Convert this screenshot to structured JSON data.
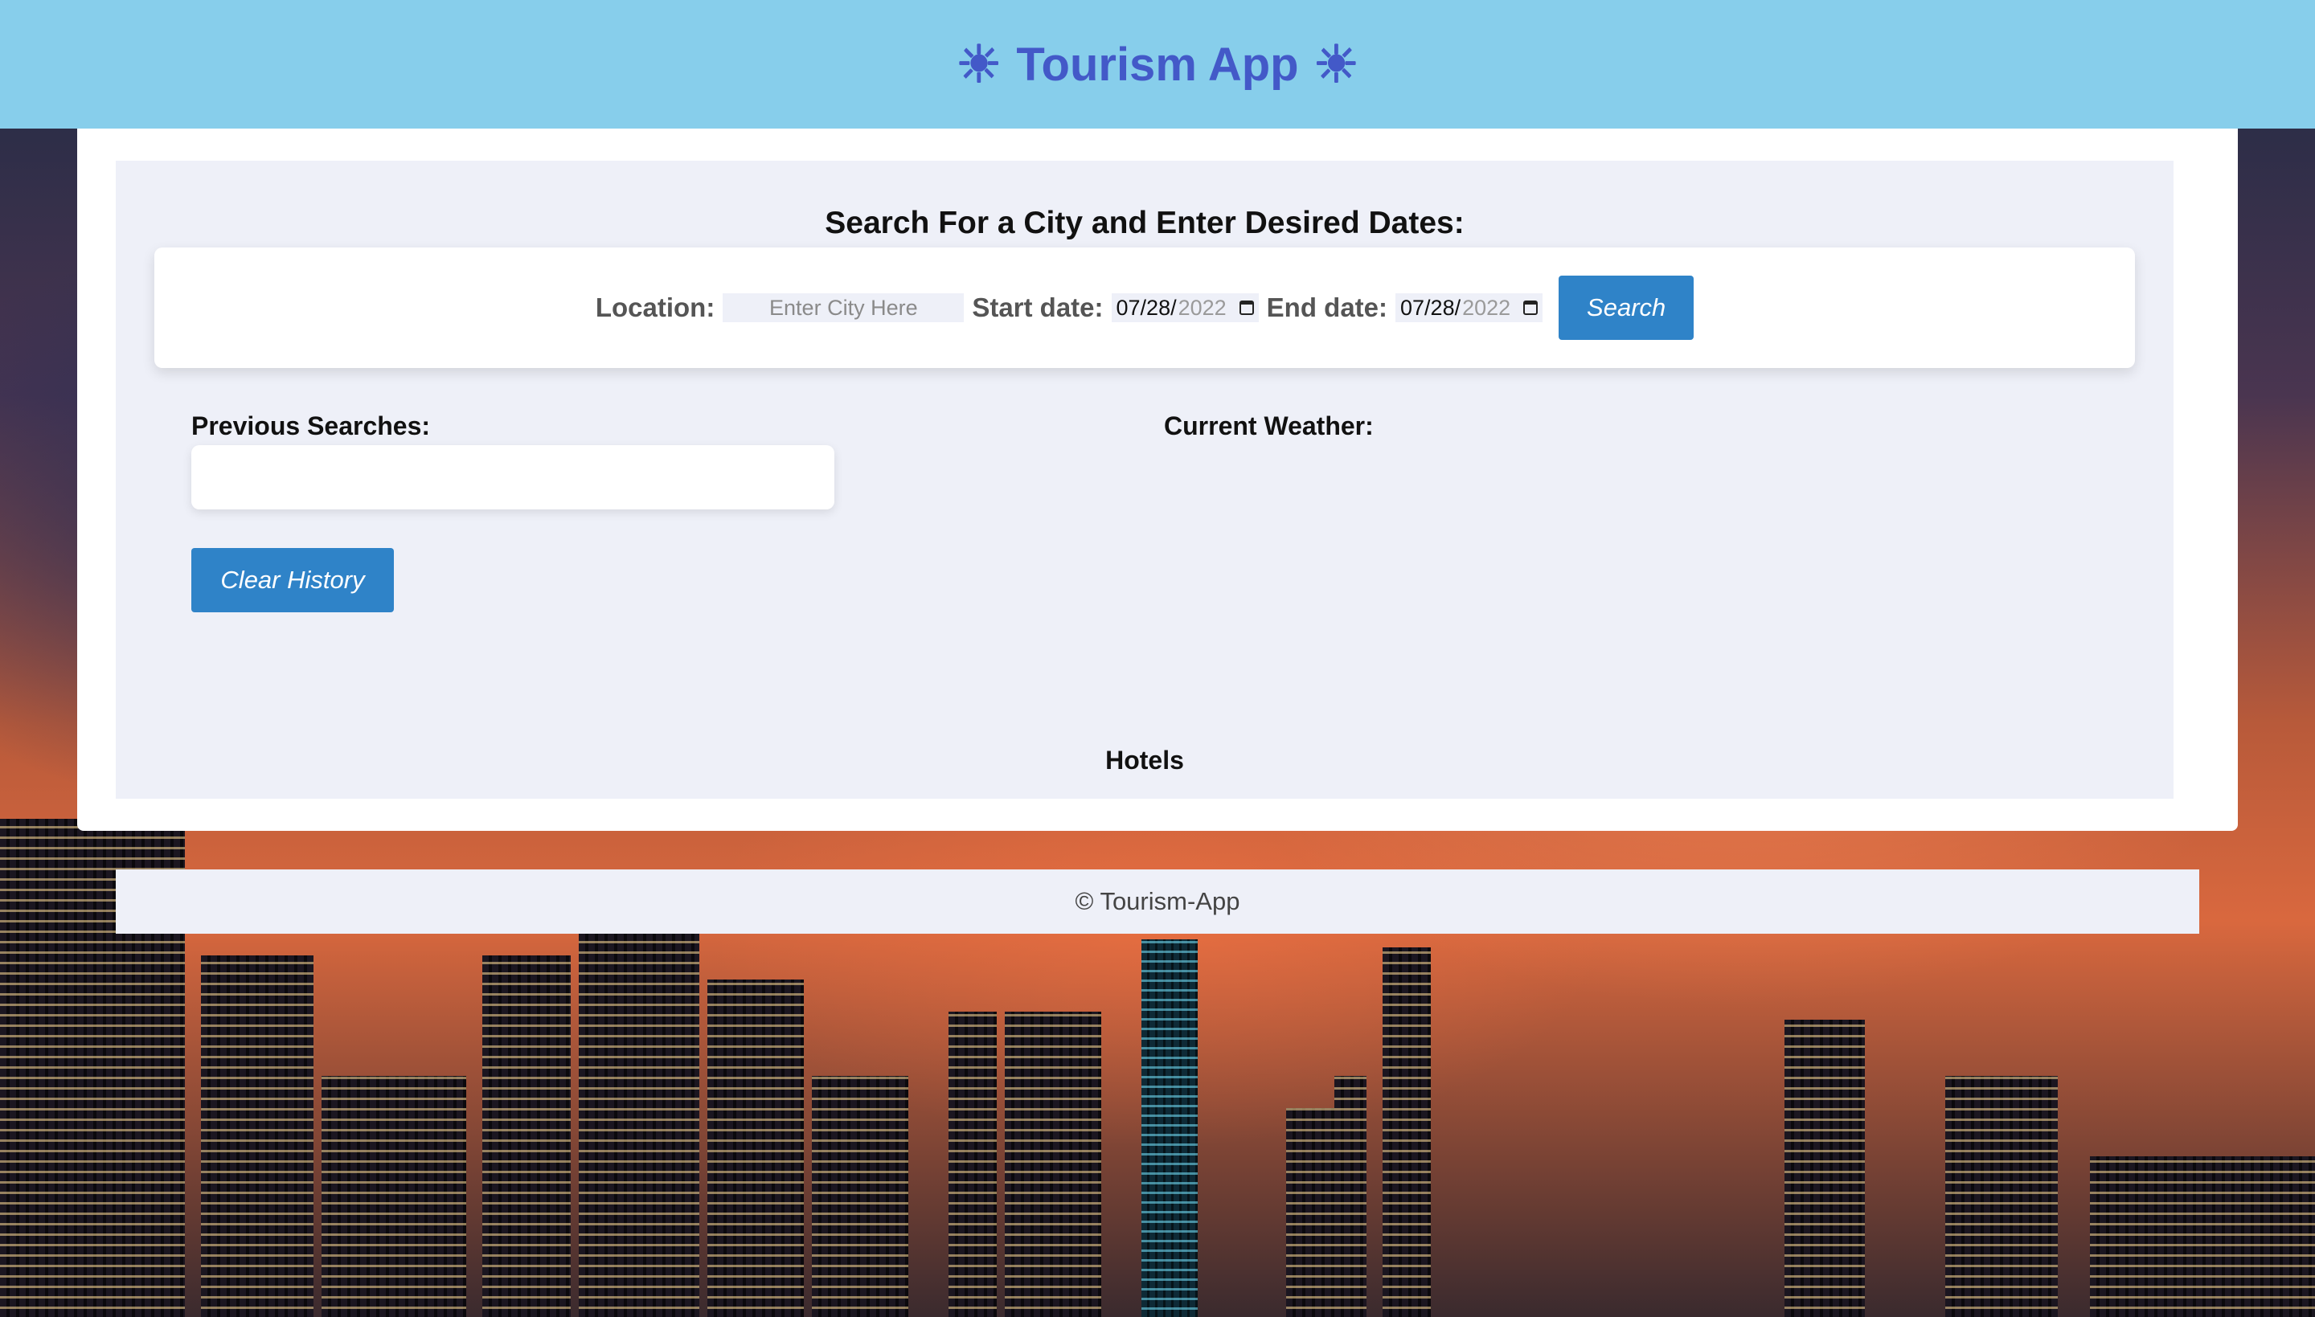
{
  "header": {
    "title": "Tourism App",
    "left_icon": "sun-icon",
    "right_icon": "sun-icon",
    "icon_glyph": "☀",
    "bg_color": "#87ceeb",
    "title_color": "#4359c8"
  },
  "search": {
    "heading": "Search For a City and Enter Desired Dates:",
    "location_label": "Location:",
    "location_placeholder": "Enter City Here",
    "start_label": "Start date:",
    "start_value_md": "07/28/",
    "start_value_year": "2022",
    "end_label": "End date:",
    "end_value_md": "07/28/",
    "end_value_year": "2022",
    "button_label": "Search",
    "button_color": "#2f83c8"
  },
  "history": {
    "heading": "Previous Searches:",
    "items": [],
    "clear_label": "Clear History"
  },
  "weather": {
    "heading": "Current Weather:"
  },
  "hotels": {
    "heading": "Hotels"
  },
  "footer": {
    "text": "© Tourism-App"
  }
}
